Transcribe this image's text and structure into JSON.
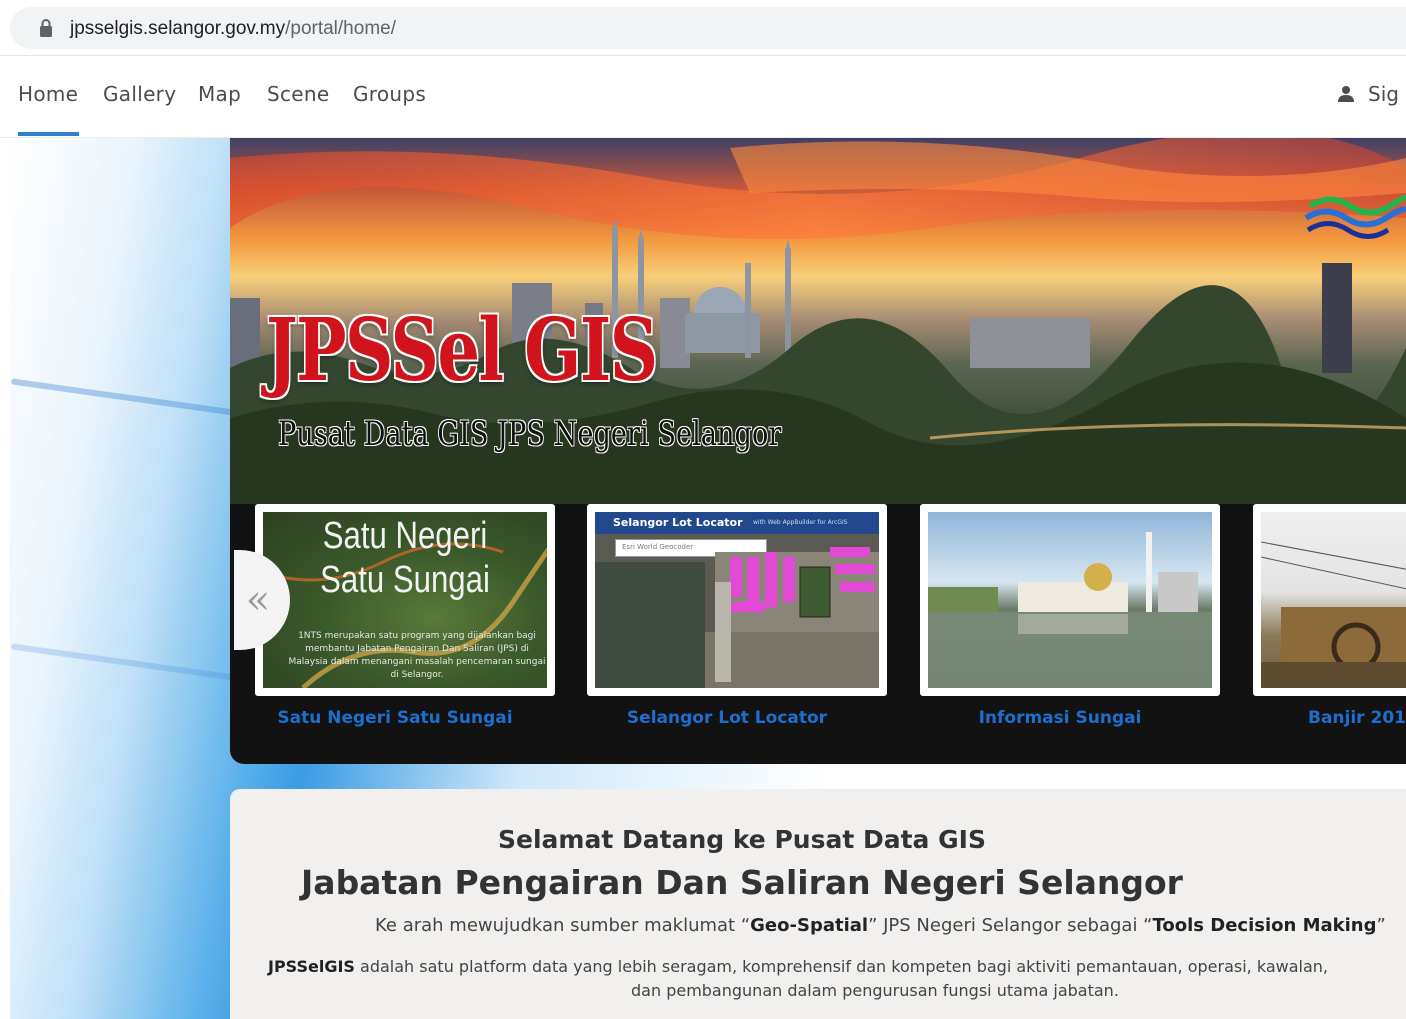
{
  "browser": {
    "url_host": "jpsselgis.selangor.gov.my",
    "url_path": "/portal/home/"
  },
  "nav": {
    "items": [
      "Home",
      "Gallery",
      "Map",
      "Scene",
      "Groups"
    ],
    "active": "Home",
    "signin": "Sign In",
    "signin_visible": "Sig"
  },
  "hero": {
    "title": "JPSSel GIS",
    "subtitle": "Pusat Data GIS JPS Negeri Selangor"
  },
  "carousel": {
    "prev_label": "«",
    "cards": [
      {
        "caption": "Satu Negeri Satu Sungai",
        "thumb_title": "Satu Negeri Satu Sungai",
        "thumb_text": "1NTS merupakan satu program yang dijalankan bagi membantu Jabatan Pengairan Dan Saliran (JPS) di Malaysia dalam menangani masalah pencemaran sungai di Selangor."
      },
      {
        "caption": "Selangor Lot Locator",
        "thumb_title": "Selangor Lot Locator",
        "thumb_sub": "with Web AppBuilder for ArcGIS",
        "thumb_search": "Esri World Geocoder"
      },
      {
        "caption": "Informasi Sungai"
      },
      {
        "caption": "Banjir 201"
      }
    ]
  },
  "welcome": {
    "heading1": "Selamat Datang ke Pusat Data GIS",
    "heading2": "Jabatan Pengairan Dan Saliran Negeri Selangor",
    "p1_pre": "Ke arah mewujudkan sumber maklumat “",
    "p1_b1": "Geo-Spatial",
    "p1_mid": "” JPS Negeri Selangor sebagai “",
    "p1_b2": "Tools Decision Making",
    "p1_post": "”",
    "p2_b": "JPSSelGIS",
    "p2_text": " adalah satu platform data yang lebih seragam, komprehensif dan kompeten bagi aktiviti pemantauan, operasi, kawalan,",
    "p3_text": "dan pembangunan dalam pengurusan fungsi utama jabatan."
  },
  "colors": {
    "accent": "#2f7fd1",
    "caption": "#1d6fce",
    "title_red": "#d0131c"
  }
}
